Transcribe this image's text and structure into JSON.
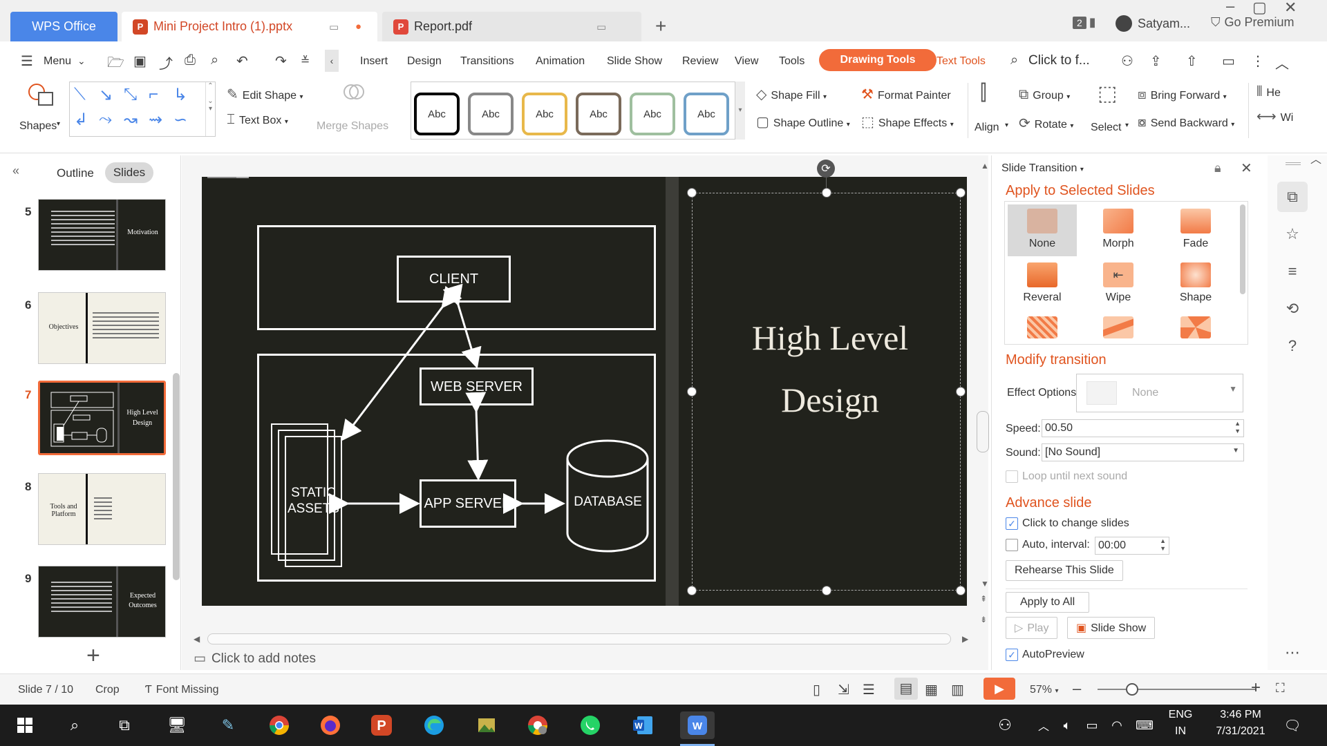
{
  "titlebar": {
    "app_tab": "WPS Office",
    "tabs": [
      {
        "label": "Mini Project Intro (1).pptx",
        "active": true
      },
      {
        "label": "Report.pdf",
        "active": false
      }
    ],
    "badge": "2",
    "user": "Satyam...",
    "premium": "Go Premium"
  },
  "menu": {
    "menu_label": "Menu",
    "tabs": [
      "Insert",
      "Design",
      "Transitions",
      "Animation",
      "Slide Show",
      "Review",
      "View",
      "Tools",
      "Drawing Tools",
      "Text Tools"
    ],
    "search_placeholder": "Click to f..."
  },
  "ribbon": {
    "shapes": "Shapes",
    "edit_shape": "Edit Shape",
    "text_box": "Text Box",
    "merge_shapes": "Merge Shapes",
    "style_samples": [
      "Abc",
      "Abc",
      "Abc",
      "Abc",
      "Abc",
      "Abc"
    ],
    "shape_fill": "Shape Fill",
    "shape_outline": "Shape Outline",
    "format_painter": "Format Painter",
    "shape_effects": "Shape Effects",
    "align": "Align",
    "group": "Group",
    "rotate": "Rotate",
    "select": "Select",
    "bring_forward": "Bring Forward",
    "send_backward": "Send Backward",
    "height_short": "He",
    "width_short": "Wi"
  },
  "left_panel": {
    "outline_tab": "Outline",
    "slides_tab": "Slides",
    "thumbs": [
      {
        "num": "5",
        "title": "Motivation",
        "theme": "dark"
      },
      {
        "num": "6",
        "title": "Objectives",
        "theme": "light"
      },
      {
        "num": "7",
        "title": "High Level Design",
        "theme": "dark",
        "selected": true
      },
      {
        "num": "8",
        "title": "Tools and Platform",
        "theme": "light"
      },
      {
        "num": "9",
        "title": "Expected Outcomes",
        "theme": "dark"
      }
    ]
  },
  "slide": {
    "boxes": {
      "client": "CLIENT",
      "web_server": "WEB SERVER",
      "app_server": "APP SERVER",
      "static_assets": "STATIC ASSETS",
      "database": "DATABASE"
    },
    "title": "High Level Design"
  },
  "notes_placeholder": "Click to add notes",
  "right_panel": {
    "header": "Slide Transition",
    "apply_section": "Apply to Selected Slides",
    "transitions": [
      "None",
      "Morph",
      "Fade",
      "Reveral",
      "Wipe",
      "Shape"
    ],
    "modify_section": "Modify transition",
    "effect_options_label": "Effect Options:",
    "effect_options_value": "None",
    "speed_label": "Speed:",
    "speed_value": "00.50",
    "sound_label": "Sound:",
    "sound_value": "[No Sound]",
    "loop_label": "Loop until next sound",
    "advance_section": "Advance slide",
    "click_change": "Click to change slides",
    "auto_interval": "Auto, interval:",
    "interval_value": "00:00",
    "rehearse": "Rehearse This Slide",
    "apply_all": "Apply to All",
    "play": "Play",
    "slide_show": "Slide Show",
    "autopreview": "AutoPreview"
  },
  "status": {
    "slide_counter": "Slide 7 / 10",
    "crop": "Crop",
    "font_missing": "Font Missing",
    "zoom": "57%",
    "zoom_level": 0.57
  },
  "taskbar": {
    "lang_top": "ENG",
    "lang_bottom": "IN",
    "time": "3:46 PM",
    "date": "7/31/2021"
  },
  "colors": {
    "accent": "#f26b3a",
    "wps_blue": "#4a86e8",
    "slide_bg": "#21221c"
  }
}
